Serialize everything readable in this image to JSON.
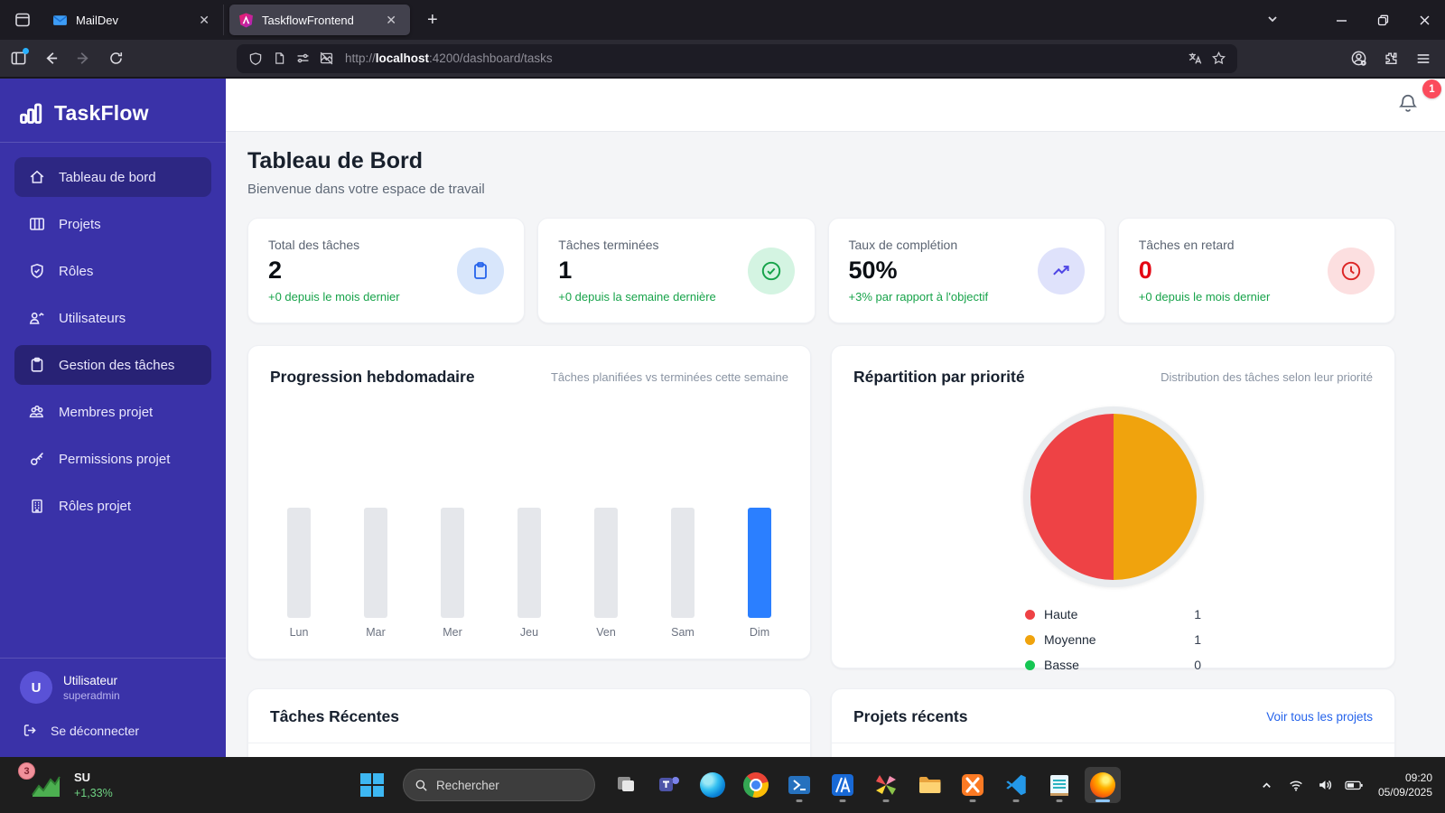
{
  "colors": {
    "sidebar_bg": "#3a32a8",
    "bar_highlight_blue": "#2b7fff",
    "bar_gray": "#e5e7eb",
    "delta_green": "#17a34a",
    "link_blue": "#2563eb",
    "notification_red": "#fb4b5c",
    "overdue_red": "#e40613"
  },
  "browser": {
    "tabs": [
      {
        "title": "MailDev"
      },
      {
        "title": "TaskflowFrontend"
      }
    ],
    "new_tab": "+",
    "url": {
      "prefix": "http://",
      "host": "localhost",
      "rest": ":4200/dashboard/tasks"
    }
  },
  "sidebar": {
    "logo_text": "TaskFlow",
    "items": [
      {
        "label": "Tableau de bord"
      },
      {
        "label": "Projets"
      },
      {
        "label": "Rôles"
      },
      {
        "label": "Utilisateurs"
      },
      {
        "label": "Gestion des tâches"
      },
      {
        "label": "Membres projet"
      },
      {
        "label": "Permissions projet"
      },
      {
        "label": "Rôles projet"
      }
    ],
    "user": {
      "initial": "U",
      "name": "Utilisateur",
      "role": "superadmin"
    },
    "logout_label": "Se déconnecter"
  },
  "topbar": {
    "notification_count": "1"
  },
  "page": {
    "title": "Tableau de Bord",
    "subtitle": "Bienvenue dans votre espace de travail"
  },
  "stats": [
    {
      "label": "Total des tâches",
      "value": "2",
      "delta": "+0 depuis le mois dernier"
    },
    {
      "label": "Tâches terminées",
      "value": "1",
      "delta": "+0 depuis la semaine dernière"
    },
    {
      "label": "Taux de complétion",
      "value": "50%",
      "delta": "+3% par rapport à l'objectif"
    },
    {
      "label": "Tâches en retard",
      "value": "0",
      "delta": "+0 depuis le mois dernier"
    }
  ],
  "chart_data": [
    {
      "type": "bar",
      "title": "Progression hebdomadaire",
      "subtitle": "Tâches planifiées vs terminées cette semaine",
      "categories": [
        "Lun",
        "Mar",
        "Mer",
        "Jeu",
        "Ven",
        "Sam",
        "Dim"
      ],
      "values": [
        1,
        1,
        1,
        1,
        1,
        1,
        1
      ],
      "colors": [
        "#e5e7eb",
        "#e5e7eb",
        "#e5e7eb",
        "#e5e7eb",
        "#e5e7eb",
        "#e5e7eb",
        "#2b7fff"
      ],
      "ylim": [
        0,
        1
      ],
      "grid": false,
      "legend": "none"
    },
    {
      "type": "pie",
      "title": "Répartition par priorité",
      "subtitle": "Distribution des tâches selon leur priorité",
      "slices": [
        {
          "label": "Haute",
          "value": 1,
          "color": "#ee4245"
        },
        {
          "label": "Moyenne",
          "value": 1,
          "color": "#f0a30d"
        },
        {
          "label": "Basse",
          "value": 0,
          "color": "#16c653"
        }
      ],
      "legend_position": "bottom"
    }
  ],
  "recent_tasks": {
    "title": "Tâches Récentes"
  },
  "recent_projects": {
    "title": "Projets récents",
    "link_label": "Voir tous les projets"
  },
  "taskbar": {
    "widget": {
      "badge": "3",
      "label": "SU",
      "change": "+1,33%"
    },
    "search_placeholder": "Rechercher",
    "clock": {
      "time": "09:20",
      "date": "05/09/2025"
    }
  }
}
